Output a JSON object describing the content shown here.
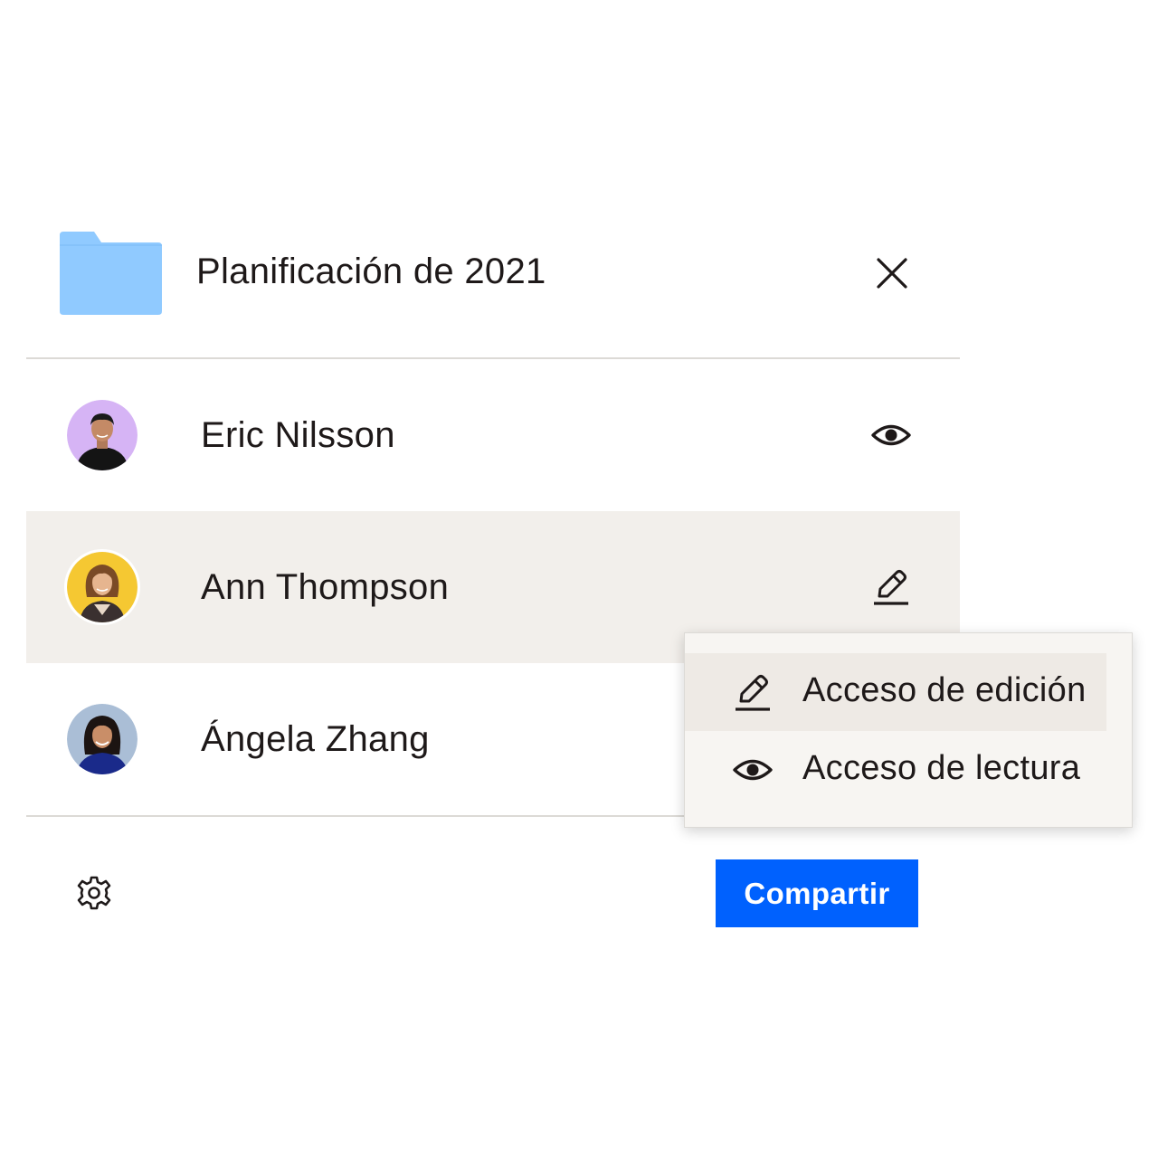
{
  "folder": {
    "title": "Planificación de 2021",
    "icon": "folder-icon",
    "color": "#90caff"
  },
  "members": [
    {
      "name": "Eric Nilsson",
      "permission_icon": "eye-icon",
      "avatar_bg": "#d6b4f5"
    },
    {
      "name": "Ann Thompson",
      "permission_icon": "pencil-icon",
      "avatar_bg": "#f5c832"
    },
    {
      "name": "Ángela Zhang",
      "permission_icon": "",
      "avatar_bg": "#aabed6"
    }
  ],
  "permission_menu": {
    "items": [
      {
        "label": "Acceso de edición",
        "icon": "pencil-icon"
      },
      {
        "label": "Acceso de lectura",
        "icon": "eye-icon"
      }
    ]
  },
  "footer": {
    "settings_icon": "gear-icon",
    "share_label": "Compartir",
    "share_color": "#0061fe"
  },
  "colors": {
    "selected_row": "#f2efeb",
    "divider": "#dcdad6",
    "text": "#1e1919"
  }
}
